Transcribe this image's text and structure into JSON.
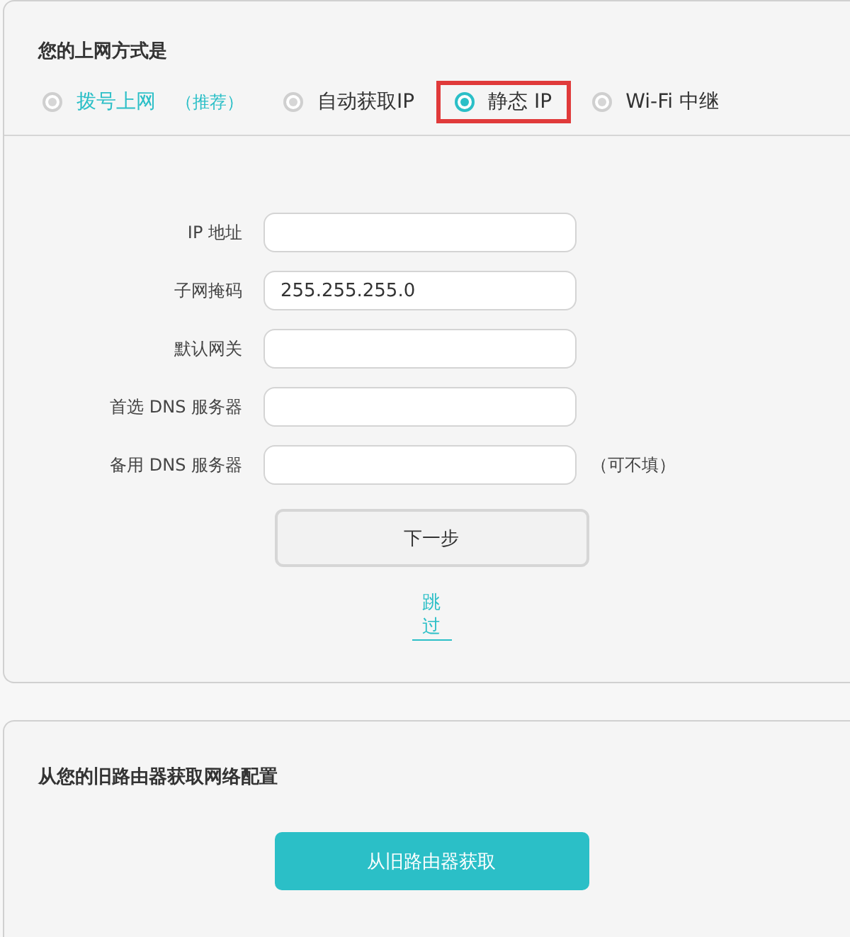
{
  "connection": {
    "title": "您的上网方式是",
    "options": [
      {
        "label": "拨号上网",
        "note": "（推荐）",
        "selected": false,
        "recommended": true,
        "highlighted": false
      },
      {
        "label": "自动获取IP",
        "selected": false,
        "recommended": false,
        "highlighted": false
      },
      {
        "label": "静态 IP",
        "selected": true,
        "recommended": false,
        "highlighted": true
      },
      {
        "label": "Wi-Fi 中继",
        "selected": false,
        "recommended": false,
        "highlighted": false
      }
    ]
  },
  "form": {
    "fields": [
      {
        "label": "IP 地址"
      },
      {
        "label": "子网掩码",
        "value": "255.255.255.0"
      },
      {
        "label": "默认网关"
      },
      {
        "label": "首选 DNS 服务器"
      },
      {
        "label": "备用 DNS 服务器",
        "hint": "（可不填）"
      }
    ],
    "next_button": "下一步",
    "skip_link": "跳过"
  },
  "old_router": {
    "title": "从您的旧路由器获取网络配置",
    "button": "从旧路由器获取"
  }
}
